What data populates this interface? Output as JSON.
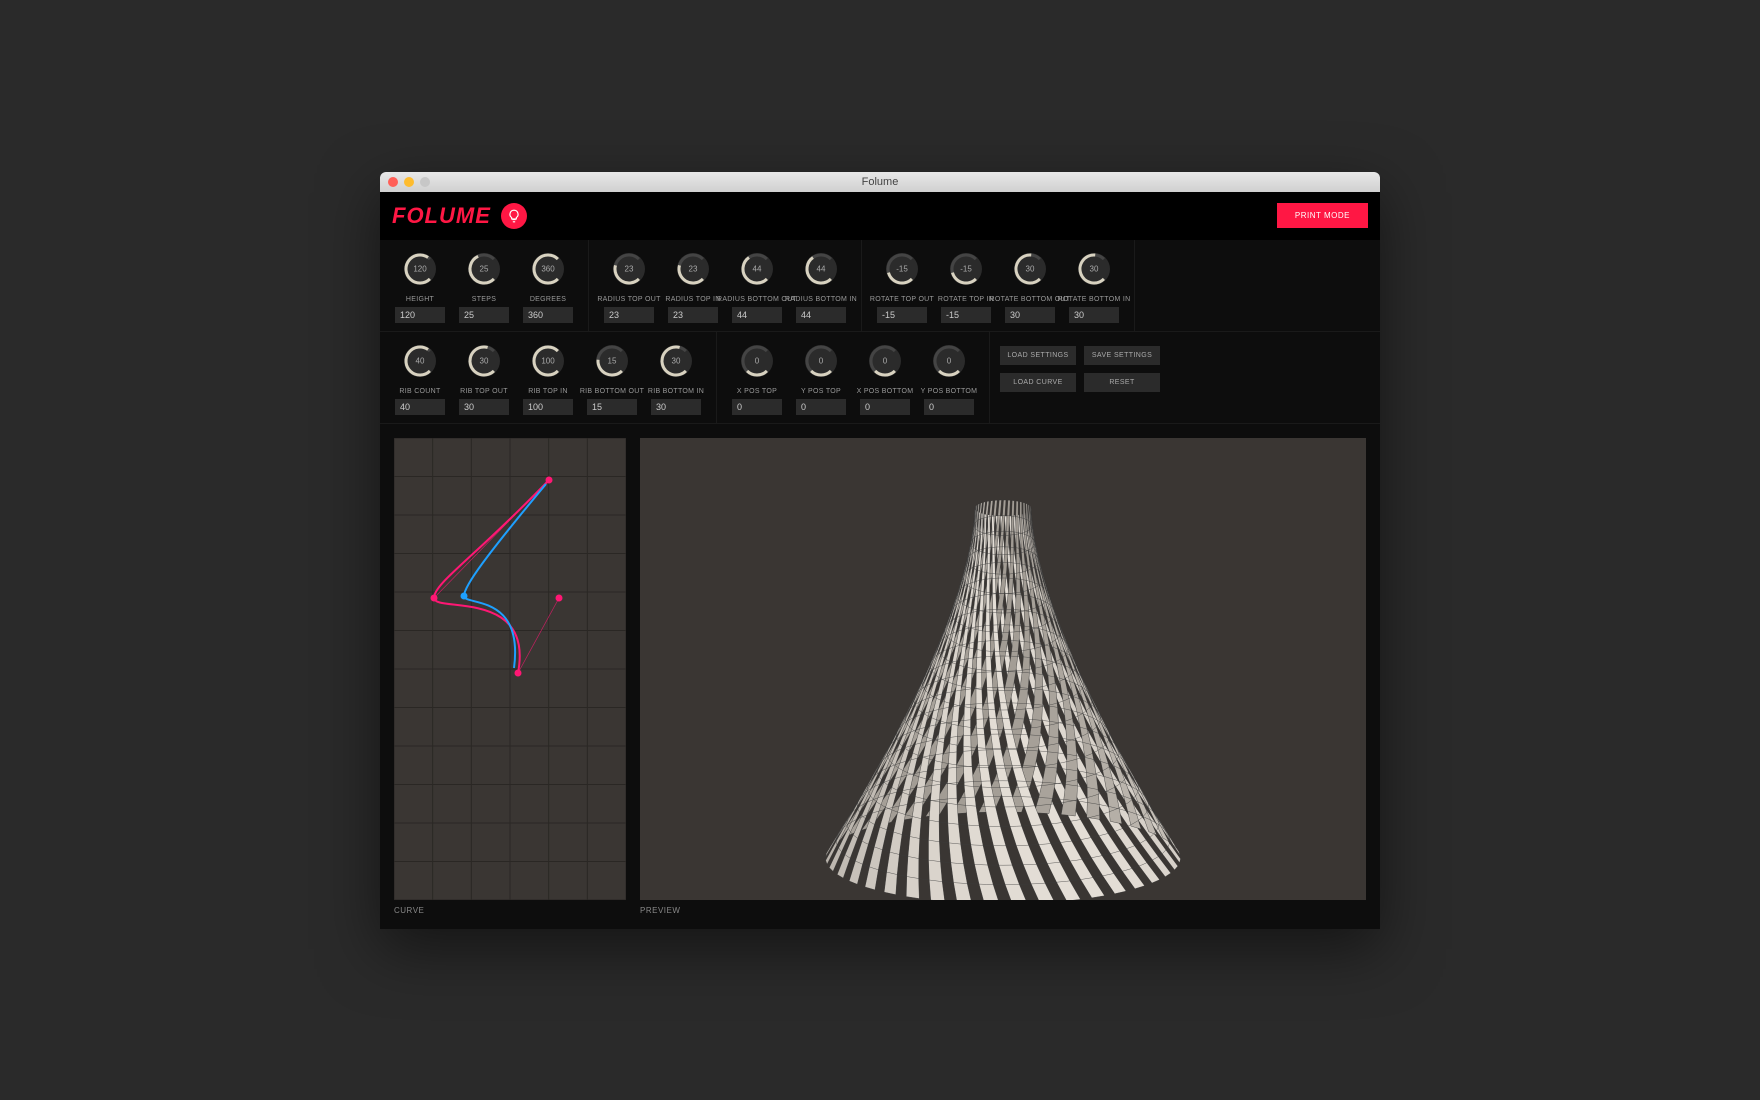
{
  "window": {
    "title": "Folume"
  },
  "header": {
    "logo": "FOLUME",
    "print_mode": "PRINT MODE"
  },
  "knobs": {
    "row1": [
      {
        "group": "basic",
        "items": [
          {
            "id": "height",
            "label": "HEIGHT",
            "display": "120",
            "value": "120",
            "angle": 260
          },
          {
            "id": "steps",
            "label": "STEPS",
            "display": "25",
            "value": "25",
            "angle": 200
          },
          {
            "id": "degrees",
            "label": "DEGREES",
            "display": "360",
            "value": "360",
            "angle": 330
          }
        ]
      },
      {
        "group": "radius",
        "items": [
          {
            "id": "rtopo",
            "label": "RADIUS TOP OUT",
            "display": "23",
            "value": "23",
            "angle": 150
          },
          {
            "id": "rtopi",
            "label": "RADIUS TOP IN",
            "display": "23",
            "value": "23",
            "angle": 150
          },
          {
            "id": "rboto",
            "label": "RADIUS BOTTOM OUT",
            "display": "44",
            "value": "44",
            "angle": 190
          },
          {
            "id": "rboti",
            "label": "RADIUS BOTTOM IN",
            "display": "44",
            "value": "44",
            "angle": 190
          }
        ]
      },
      {
        "group": "rotate",
        "items": [
          {
            "id": "rottopo",
            "label": "ROTATE TOP OUT",
            "display": "-15",
            "value": "-15",
            "angle": 120
          },
          {
            "id": "rottopi",
            "label": "ROTATE TOP IN",
            "display": "-15",
            "value": "-15",
            "angle": 120
          },
          {
            "id": "rotboto",
            "label": "ROTATE BOTTOM OUT",
            "display": "30",
            "value": "30",
            "angle": 230
          },
          {
            "id": "rotboti",
            "label": "ROTATE BOTTOM IN",
            "display": "30",
            "value": "30",
            "angle": 230
          }
        ]
      }
    ],
    "row2": [
      {
        "group": "rib",
        "items": [
          {
            "id": "ribcount",
            "label": "RIB COUNT",
            "display": "40",
            "value": "40",
            "angle": 260
          },
          {
            "id": "ribtopo",
            "label": "RIB TOP OUT",
            "display": "30",
            "value": "30",
            "angle": 240
          },
          {
            "id": "ribtopi",
            "label": "RIB TOP IN",
            "display": "100",
            "value": "100",
            "angle": 330
          },
          {
            "id": "ribboto",
            "label": "RIB BOTTOM OUT",
            "display": "15",
            "value": "15",
            "angle": 140
          },
          {
            "id": "ribboti",
            "label": "RIB BOTTOM IN",
            "display": "30",
            "value": "30",
            "angle": 240
          }
        ]
      },
      {
        "group": "pos",
        "items": [
          {
            "id": "xpt",
            "label": "X POS TOP",
            "display": "0",
            "value": "0",
            "angle": 90
          },
          {
            "id": "ypt",
            "label": "Y POS TOP",
            "display": "0",
            "value": "0",
            "angle": 90
          },
          {
            "id": "xpb",
            "label": "X POS BOTTOM",
            "display": "0",
            "value": "0",
            "angle": 90
          },
          {
            "id": "ypb",
            "label": "Y POS BOTTOM",
            "display": "0",
            "value": "0",
            "angle": 90
          }
        ]
      }
    ]
  },
  "buttons": {
    "load_settings": "LOAD SETTINGS",
    "save_settings": "SAVE SETTINGS",
    "load_curve": "LOAD CURVE",
    "reset": "RESET"
  },
  "panels": {
    "curve": "CURVE",
    "preview": "PREVIEW"
  }
}
